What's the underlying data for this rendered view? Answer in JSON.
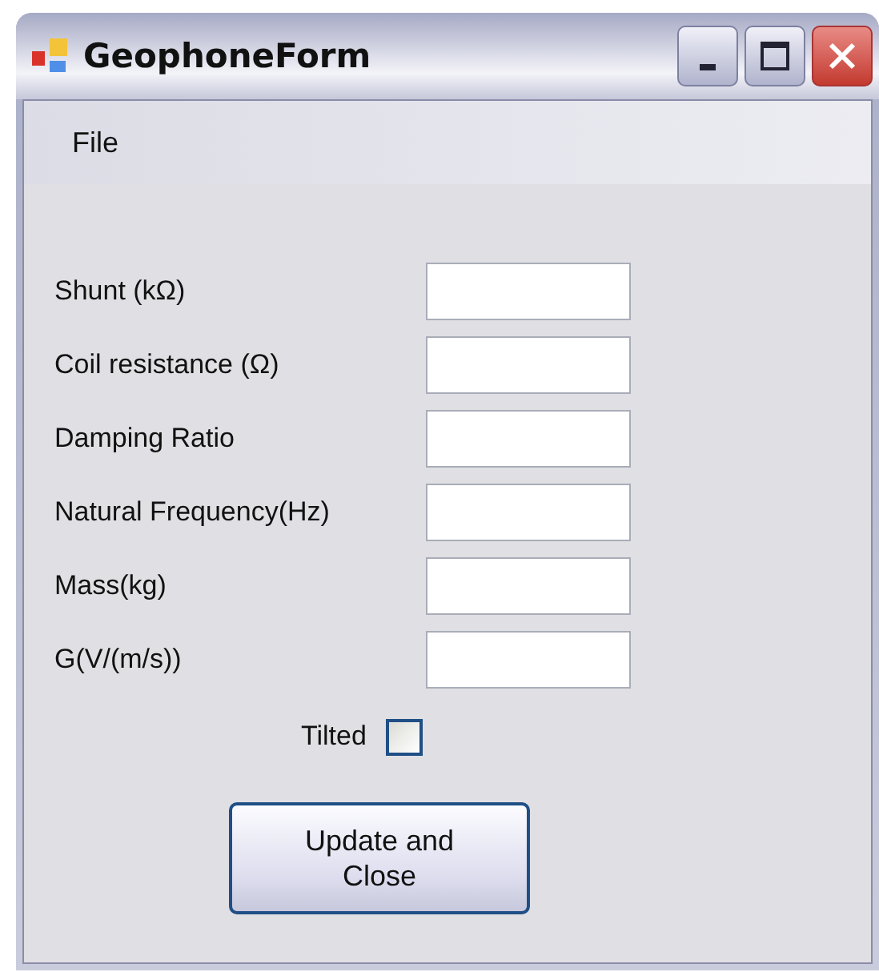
{
  "window": {
    "title": "GeophoneForm"
  },
  "menu": [
    "File"
  ],
  "fields": [
    {
      "label": "Shunt (kΩ)"
    },
    {
      "label": "Coil resistance (Ω)"
    },
    {
      "label": "Damping Ratio"
    },
    {
      "label": "Natural Frequency(Hz)"
    },
    {
      "label": "Mass(kg)"
    },
    {
      "label": "G(V/(m/s))"
    }
  ],
  "tilted": {
    "label": "Tilted",
    "checked": false
  },
  "button": "Update and\nClose"
}
